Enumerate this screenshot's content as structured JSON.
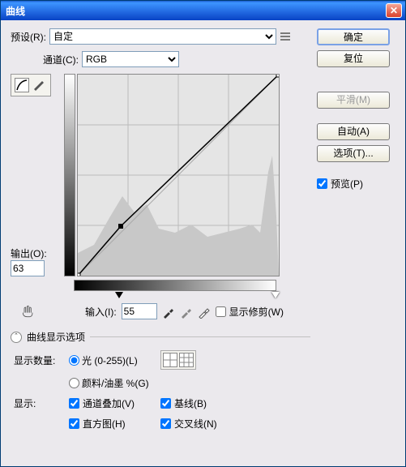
{
  "window": {
    "title": "曲线"
  },
  "preset": {
    "label": "预设(R):",
    "value": "自定"
  },
  "channel": {
    "label": "通道(C):",
    "value": "RGB"
  },
  "output": {
    "label": "输出(O):",
    "value": "63"
  },
  "input": {
    "label": "输入(I):",
    "value": "55"
  },
  "show_clipping": {
    "label": "显示修剪(W)"
  },
  "expand": {
    "label": "曲线显示选项"
  },
  "amount": {
    "label": "显示数量:",
    "opt1": "光 (0-255)(L)",
    "opt2": "颜料/油墨 %(G)"
  },
  "show": {
    "label": "显示:",
    "c1": "通道叠加(V)",
    "c2": "基线(B)",
    "c3": "直方图(H)",
    "c4": "交叉线(N)"
  },
  "buttons": {
    "ok": "确定",
    "reset": "复位",
    "smooth": "平滑(M)",
    "auto": "自动(A)",
    "options": "选项(T)..."
  },
  "preview": {
    "label": "预览(P)"
  },
  "curve": {
    "point": {
      "x": 55,
      "y": 63
    }
  }
}
